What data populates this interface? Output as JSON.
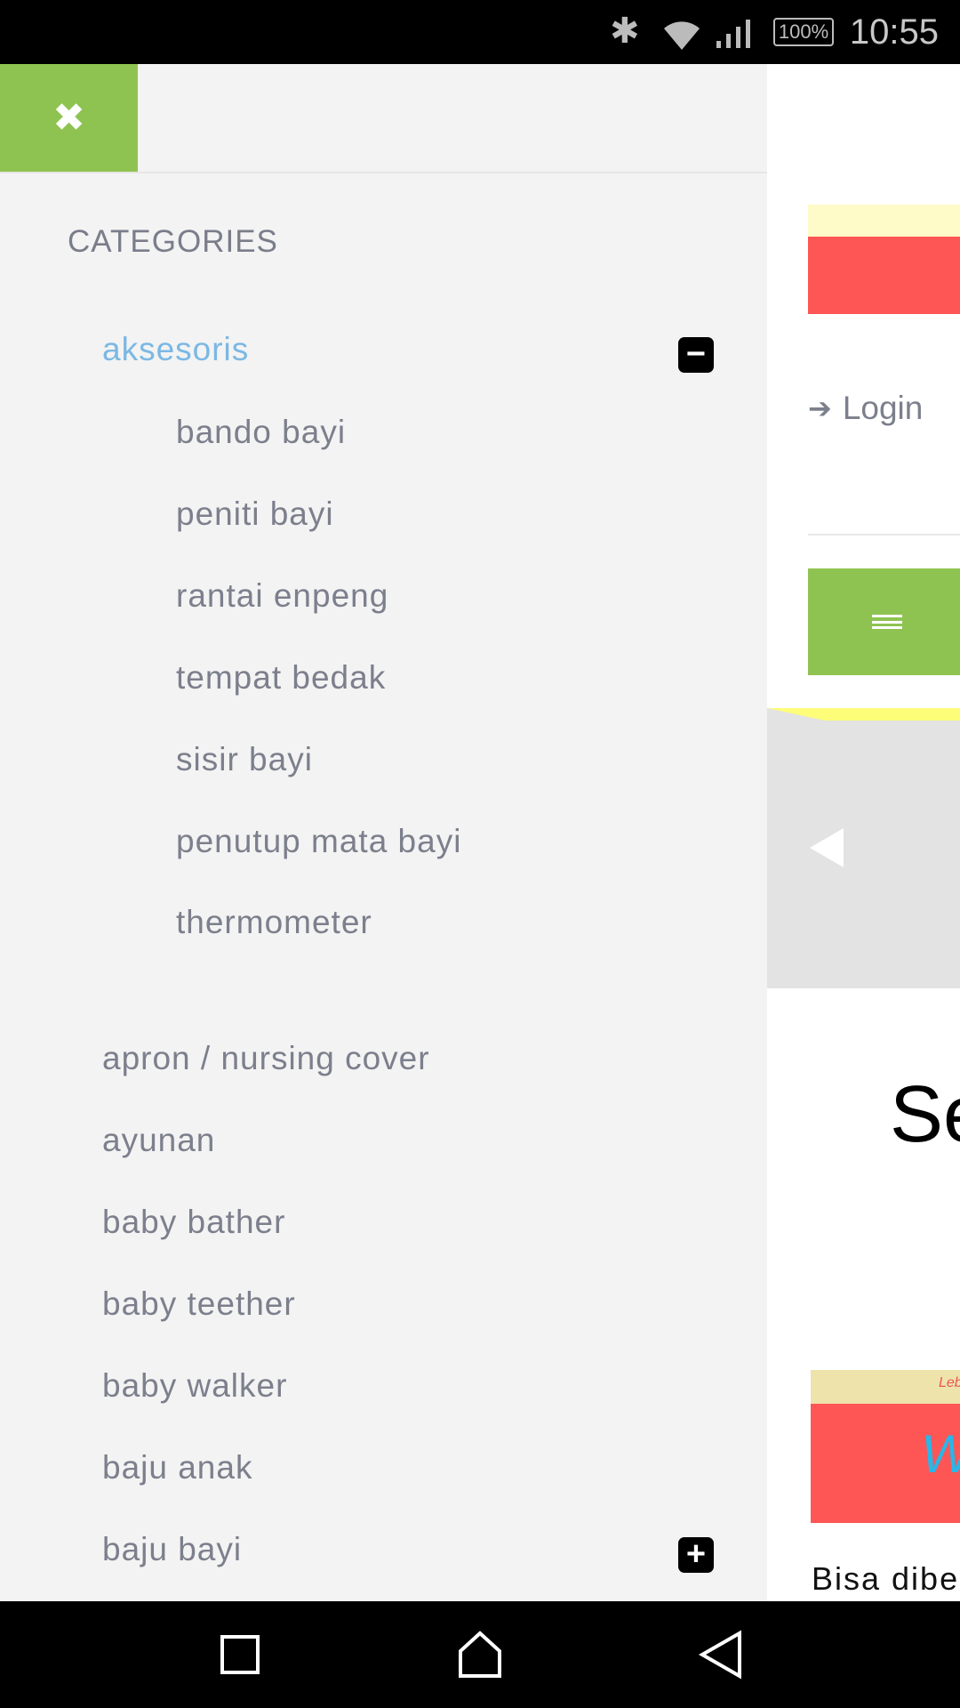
{
  "status_bar": {
    "time": "10:55",
    "battery": "100%",
    "icons": [
      "bluetooth-icon",
      "wifi-icon",
      "signal-icon",
      "battery-icon"
    ]
  },
  "drawer": {
    "close_icon": "✖",
    "title": "CATEGORIES",
    "categories": [
      {
        "label": "aksesoris",
        "expanded": true,
        "toggle": "−",
        "children": [
          "bando bayi",
          "peniti bayi",
          "rantai enpeng",
          "tempat bedak",
          "sisir bayi",
          "penutup mata bayi",
          "thermometer"
        ]
      },
      {
        "label": "apron / nursing cover"
      },
      {
        "label": "ayunan"
      },
      {
        "label": "baby bather"
      },
      {
        "label": "baby teether"
      },
      {
        "label": "baby walker"
      },
      {
        "label": "baju anak"
      },
      {
        "label": "baju bayi",
        "toggle": "+"
      }
    ]
  },
  "page": {
    "login": "Login",
    "heading_partial": "Se",
    "banner_text_partial": "W",
    "banner_small_partial": "Leb",
    "body_text_partial": "Bisa dibe"
  },
  "colors": {
    "accent_green": "#8fc351",
    "active_link": "#7bb8e4",
    "banner_red": "#fe5555",
    "banner_yellow": "#fffbc8"
  }
}
